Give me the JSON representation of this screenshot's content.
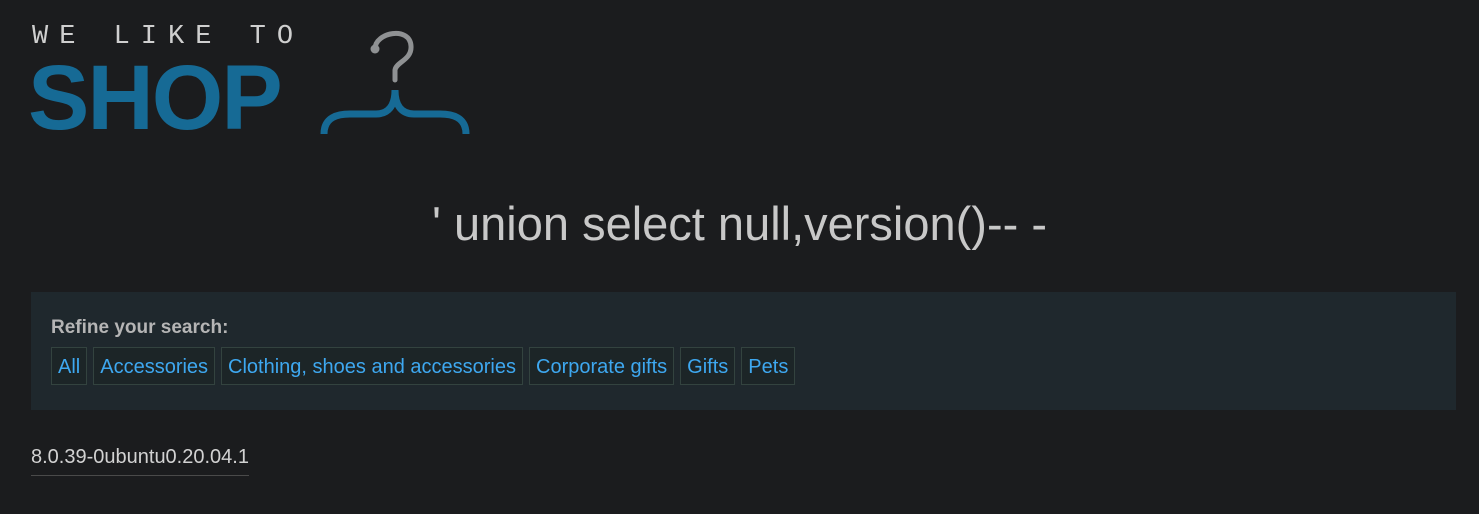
{
  "logo": {
    "tagline": "WE LIKE TO",
    "word": "SHOP",
    "icon": "hanger-icon",
    "colors": {
      "tagline": "#cfcfcf",
      "word": "#166a95",
      "hanger_hook": "#8f9193",
      "hanger_bar": "#166a95"
    }
  },
  "search": {
    "title": "' union select null,version()-- -"
  },
  "filters": {
    "label": "Refine your search:",
    "items": [
      {
        "label": "All"
      },
      {
        "label": "Accessories"
      },
      {
        "label": "Clothing, shoes and accessories"
      },
      {
        "label": "Corporate gifts"
      },
      {
        "label": "Gifts"
      },
      {
        "label": "Pets"
      }
    ]
  },
  "results": {
    "value": "8.0.39-0ubuntu0.20.04.1"
  },
  "colors": {
    "background": "#1b1c1e",
    "panel": "#1f282d",
    "link": "#3ea8f0"
  }
}
